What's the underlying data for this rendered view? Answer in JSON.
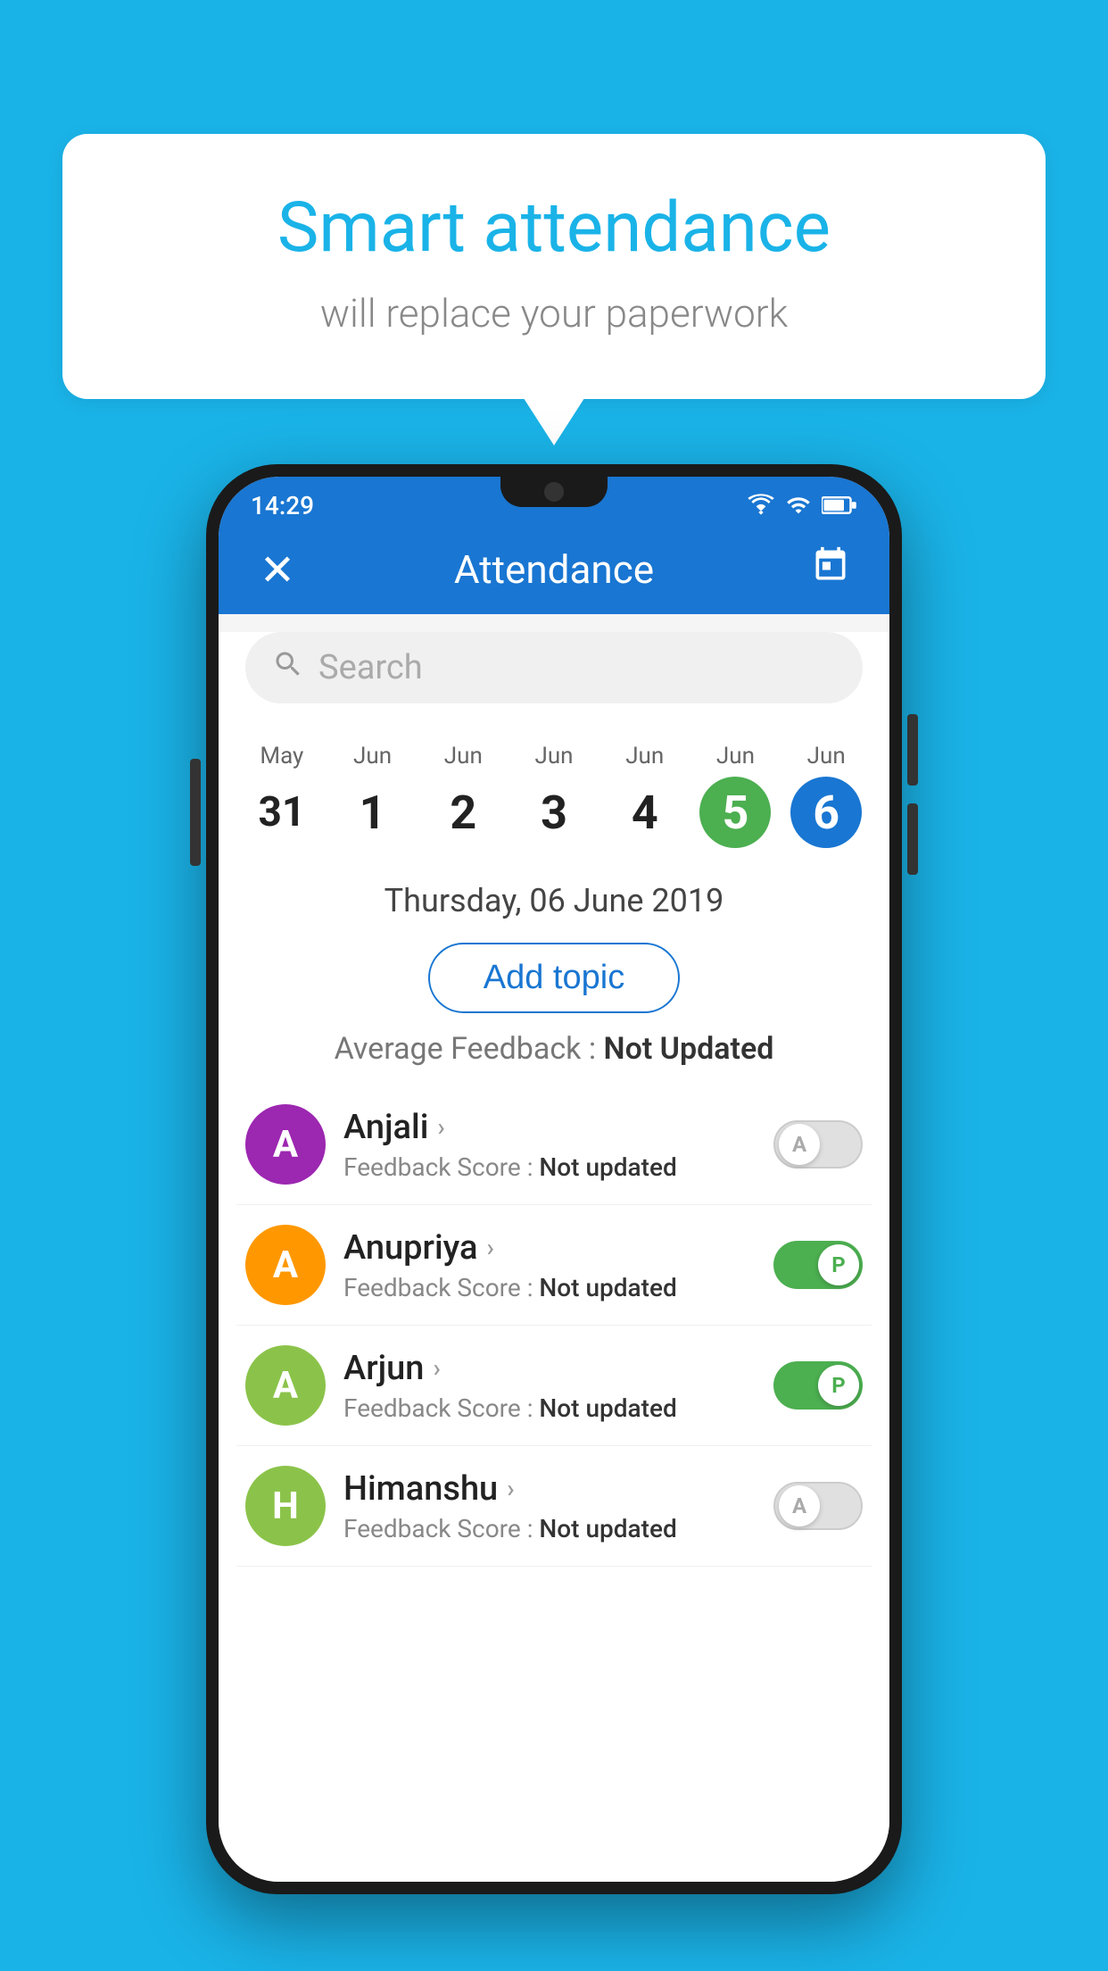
{
  "background_color": "#1ab3e8",
  "speech_bubble": {
    "title": "Smart attendance",
    "subtitle": "will replace your paperwork"
  },
  "status_bar": {
    "time": "14:29"
  },
  "app_bar": {
    "close_icon": "×",
    "title": "Attendance",
    "calendar_icon": "📅"
  },
  "search": {
    "placeholder": "Search"
  },
  "dates": [
    {
      "month": "May",
      "day": "31",
      "state": "normal"
    },
    {
      "month": "Jun",
      "day": "1",
      "state": "normal"
    },
    {
      "month": "Jun",
      "day": "2",
      "state": "normal"
    },
    {
      "month": "Jun",
      "day": "3",
      "state": "normal"
    },
    {
      "month": "Jun",
      "day": "4",
      "state": "normal"
    },
    {
      "month": "Jun",
      "day": "5",
      "state": "today"
    },
    {
      "month": "Jun",
      "day": "6",
      "state": "selected"
    }
  ],
  "selected_date_label": "Thursday, 06 June 2019",
  "add_topic_label": "Add topic",
  "avg_feedback_label": "Average Feedback : Not Updated",
  "students": [
    {
      "name": "Anjali",
      "initial": "A",
      "avatar_color": "#9c27b0",
      "feedback": "Not updated",
      "attendance": "absent"
    },
    {
      "name": "Anupriya",
      "initial": "A",
      "avatar_color": "#ff9800",
      "feedback": "Not updated",
      "attendance": "present"
    },
    {
      "name": "Arjun",
      "initial": "A",
      "avatar_color": "#8bc34a",
      "feedback": "Not updated",
      "attendance": "present"
    },
    {
      "name": "Himanshu",
      "initial": "H",
      "avatar_color": "#8bc34a",
      "feedback": "Not updated",
      "attendance": "absent"
    }
  ],
  "feedback_label": "Feedback Score :"
}
